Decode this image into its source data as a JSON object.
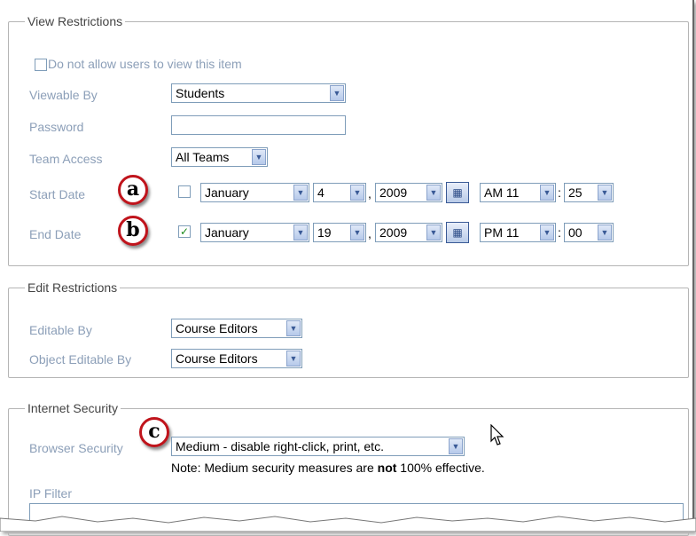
{
  "view_restrictions": {
    "legend": "View Restrictions",
    "do_not_allow": "Do not allow users to view this item",
    "viewable_by": {
      "label": "Viewable By",
      "value": "Students"
    },
    "password": {
      "label": "Password",
      "value": ""
    },
    "team_access": {
      "label": "Team Access",
      "value": "All Teams"
    },
    "start_date": {
      "label": "Start Date",
      "checked": false,
      "month": "January",
      "day": "4",
      "year": "2009",
      "ampm_hour": "AM 11",
      "minute": "25"
    },
    "end_date": {
      "label": "End Date",
      "checked": true,
      "month": "January",
      "day": "19",
      "year": "2009",
      "ampm_hour": "PM 11",
      "minute": "00"
    }
  },
  "edit_restrictions": {
    "legend": "Edit Restrictions",
    "editable_by": {
      "label": "Editable By",
      "value": "Course Editors"
    },
    "object_editable_by": {
      "label": "Object Editable By",
      "value": "Course Editors"
    }
  },
  "internet_security": {
    "legend": "Internet Security",
    "browser_security": {
      "label": "Browser Security",
      "value": "Medium - disable right-click, print, etc."
    },
    "note_prefix": "Note: Medium security measures are ",
    "note_bold": "not",
    "note_suffix": " 100% effective.",
    "ip_filter": {
      "label": "IP Filter"
    }
  },
  "callouts": {
    "a": "a",
    "b": "b",
    "c": "c"
  },
  "colors": {
    "label_text": "#8c9fb8",
    "callout_ring": "#c0141c",
    "border": "#7f9db9"
  }
}
